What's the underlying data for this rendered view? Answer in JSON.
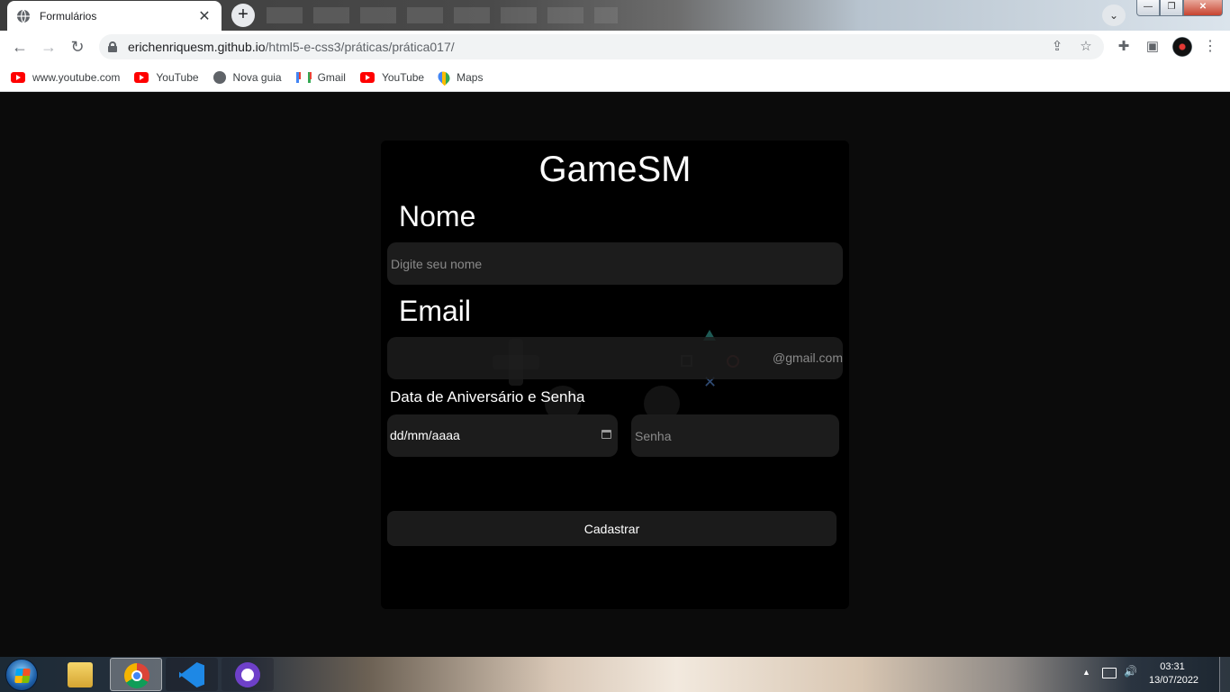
{
  "browser": {
    "tab": {
      "title": "Formulários",
      "close_glyph": "✕"
    },
    "new_tab_glyph": "+",
    "tab_search_glyph": "⌄",
    "window_controls": {
      "minimize": "—",
      "maximize": "❐",
      "close": "✕"
    },
    "nav": {
      "back": "←",
      "forward": "→",
      "reload": "↻"
    },
    "address": {
      "host": "erichenriquesm.github.io",
      "path": "/html5-e-css3/práticas/prática017/"
    },
    "toolbar_icons": {
      "share": "⇪",
      "bookmark_star": "☆",
      "extensions": "✚",
      "side_panel": "▣",
      "menu": "⋮"
    },
    "bookmarks": [
      {
        "label": "www.youtube.com",
        "icon": "youtube-icon"
      },
      {
        "label": "YouTube",
        "icon": "youtube-icon"
      },
      {
        "label": "Nova guia",
        "icon": "globe-icon"
      },
      {
        "label": "Gmail",
        "icon": "gmail-icon"
      },
      {
        "label": "YouTube",
        "icon": "youtube-icon"
      },
      {
        "label": "Maps",
        "icon": "maps-icon"
      }
    ]
  },
  "form": {
    "brand": "GameSM",
    "name_label": "Nome",
    "name_placeholder": "Digite seu nome",
    "email_label": "Email",
    "email_suffix": "@gmail.com",
    "birth_password_label": "Data de Aniversário e Senha",
    "date_value": "dd/mm/aaaa",
    "password_placeholder": "Senha",
    "submit_label": "Cadastrar"
  },
  "taskbar": {
    "apps": [
      "file-explorer",
      "google-chrome",
      "visual-studio-code",
      "github-desktop"
    ],
    "active_app": "google-chrome",
    "tray_arrow": "▲",
    "volume_glyph": "🔊",
    "time": "03:31",
    "date": "13/07/2022"
  },
  "colors": {
    "page_background": "#0b0b0b",
    "card_background": "#000000",
    "input_background": "#1c1c1c",
    "text": "#ffffff"
  }
}
